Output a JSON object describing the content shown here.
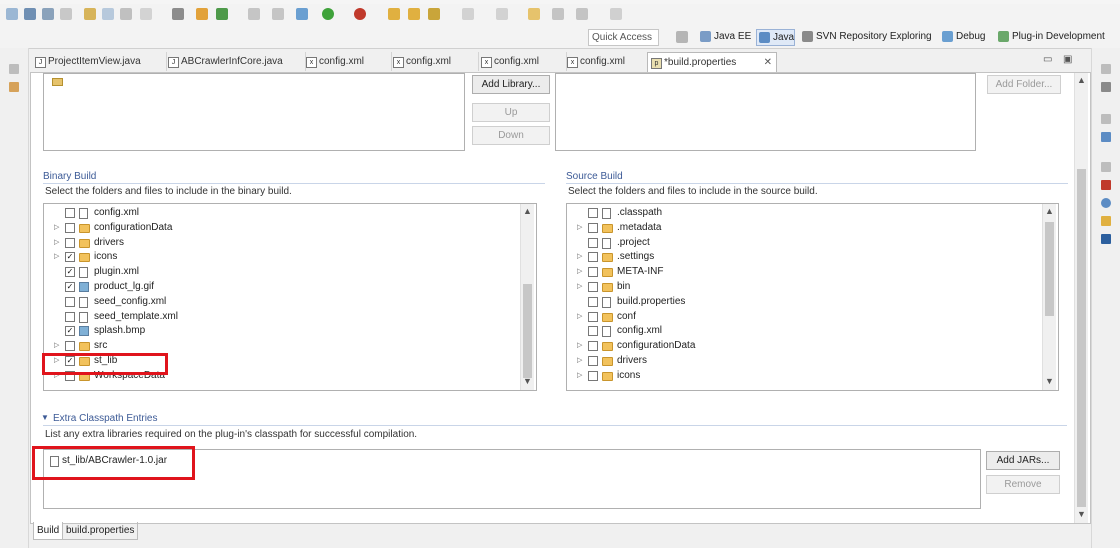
{
  "toolbar": {
    "quick_access_placeholder": "Quick Access",
    "perspectives": [
      {
        "label": "Java EE",
        "active": false
      },
      {
        "label": "Java",
        "active": true
      },
      {
        "label": "SVN Repository Exploring",
        "active": false
      },
      {
        "label": "Debug",
        "active": false
      },
      {
        "label": "Plug-in Development",
        "active": false
      }
    ]
  },
  "tabs": [
    {
      "label": "ProjectItemView.java"
    },
    {
      "label": "ABCrawlerInfCore.java"
    },
    {
      "label": "config.xml"
    },
    {
      "label": "config.xml"
    },
    {
      "label": "config.xml"
    },
    {
      "label": "config.xml"
    },
    {
      "label": "*build.properties",
      "active": true
    }
  ],
  "top_buttons": {
    "add_library": "Add Library...",
    "up": "Up",
    "down": "Down",
    "add_folder": "Add Folder..."
  },
  "binary_build": {
    "title": "Binary Build",
    "description": "Select the folders and files to include in the binary build.",
    "items": [
      {
        "name": "config.xml",
        "checked": false,
        "expandable": false,
        "type": "file"
      },
      {
        "name": "configurationData",
        "checked": false,
        "expandable": true,
        "type": "folder"
      },
      {
        "name": "drivers",
        "checked": false,
        "expandable": true,
        "type": "folder"
      },
      {
        "name": "icons",
        "checked": true,
        "expandable": true,
        "type": "folder"
      },
      {
        "name": "plugin.xml",
        "checked": true,
        "expandable": false,
        "type": "file"
      },
      {
        "name": "product_lg.gif",
        "checked": true,
        "expandable": false,
        "type": "image"
      },
      {
        "name": "seed_config.xml",
        "checked": false,
        "expandable": false,
        "type": "file"
      },
      {
        "name": "seed_template.xml",
        "checked": false,
        "expandable": false,
        "type": "file"
      },
      {
        "name": "splash.bmp",
        "checked": true,
        "expandable": false,
        "type": "image"
      },
      {
        "name": "src",
        "checked": false,
        "expandable": true,
        "type": "folder"
      },
      {
        "name": "st_lib",
        "checked": true,
        "expandable": true,
        "type": "folder"
      },
      {
        "name": "WorkspaceData",
        "checked": false,
        "expandable": true,
        "type": "folder"
      }
    ]
  },
  "source_build": {
    "title": "Source Build",
    "description": "Select the folders and files to include in the source build.",
    "items": [
      {
        "name": ".classpath",
        "checked": false,
        "expandable": false,
        "type": "file"
      },
      {
        "name": ".metadata",
        "checked": false,
        "expandable": true,
        "type": "folder"
      },
      {
        "name": ".project",
        "checked": false,
        "expandable": false,
        "type": "file"
      },
      {
        "name": ".settings",
        "checked": false,
        "expandable": true,
        "type": "folder"
      },
      {
        "name": "META-INF",
        "checked": false,
        "expandable": true,
        "type": "folder"
      },
      {
        "name": "bin",
        "checked": false,
        "expandable": true,
        "type": "folder"
      },
      {
        "name": "build.properties",
        "checked": false,
        "expandable": false,
        "type": "file"
      },
      {
        "name": "conf",
        "checked": false,
        "expandable": true,
        "type": "folder"
      },
      {
        "name": "config.xml",
        "checked": false,
        "expandable": false,
        "type": "file"
      },
      {
        "name": "configurationData",
        "checked": false,
        "expandable": true,
        "type": "folder"
      },
      {
        "name": "drivers",
        "checked": false,
        "expandable": true,
        "type": "folder"
      },
      {
        "name": "icons",
        "checked": false,
        "expandable": true,
        "type": "folder"
      }
    ]
  },
  "extra_classpath": {
    "title": "Extra Classpath Entries",
    "description": "List any extra libraries required on the plug-in's classpath for successful compilation.",
    "entries": [
      "st_lib/ABCrawler-1.0.jar"
    ],
    "add_jars": "Add JARs...",
    "remove": "Remove"
  },
  "bottom_tabs": [
    {
      "label": "Build",
      "active": true
    },
    {
      "label": "build.properties",
      "active": false
    }
  ],
  "colors": {
    "highlight": "#e0141c",
    "section_title": "#3c5a96"
  }
}
